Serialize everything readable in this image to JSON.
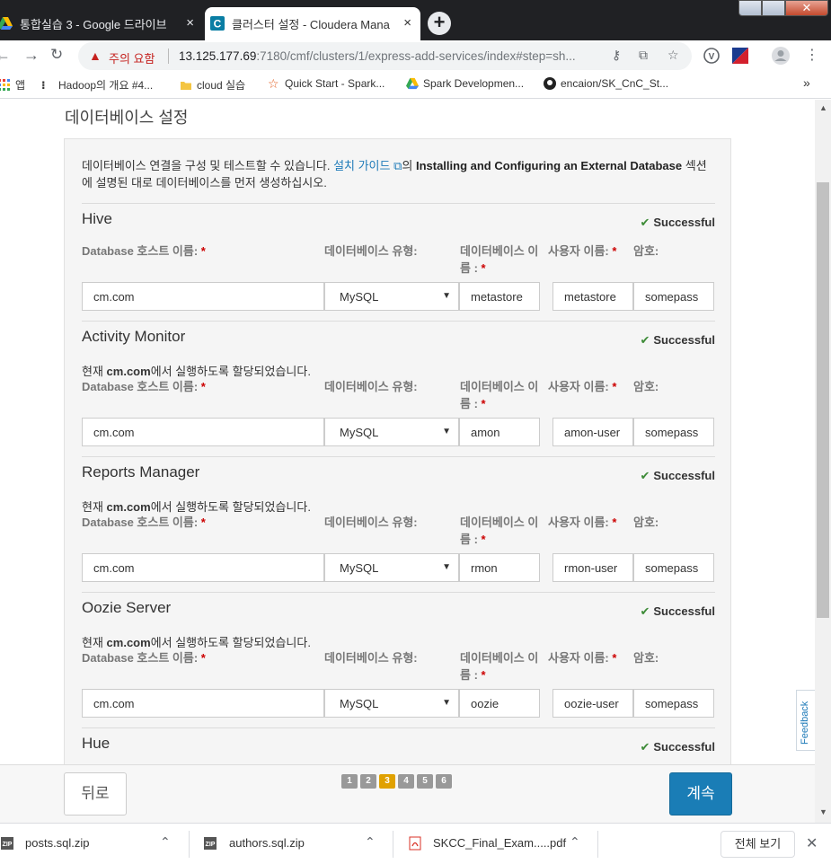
{
  "browser": {
    "tabs": [
      {
        "title": "통합실습 3 - Google 드라이브",
        "close": "×"
      },
      {
        "title": "클러스터 설정 - Cloudera Mana",
        "close": "×"
      }
    ],
    "new_tab": "+",
    "window_close": "✕",
    "security_warning": "주의 요함",
    "url_host": "13.125.177.69",
    "url_rest": ":7180/cmf/clusters/1/express-add-services/index#step=sh...",
    "bookmarks": [
      {
        "label": "앱"
      },
      {
        "label": "Hadoop의 개요 #4..."
      },
      {
        "label": "cloud 실습"
      },
      {
        "label": "Quick Start - Spark..."
      },
      {
        "label": "Spark Developmen..."
      },
      {
        "label": "encaion/SK_CnC_St..."
      }
    ],
    "more_bookmarks": "»"
  },
  "page": {
    "title": "데이터베이스 설정",
    "intro_text": "데이터베이스 연결을 구성 및 테스트할 수 있습니다. ",
    "intro_link": "설치 가이드",
    "intro_after_link": "의 ",
    "intro_bold": "Installing and Configuring an External Database",
    "intro_tail": " 섹션에 설명된 대로 데이터베이스를 먼저 생성하십시오.",
    "labels": {
      "host": "Database 호스트 이름:",
      "type": "데이터베이스 유형:",
      "name_line1": "데이터베이스 이",
      "name_line2": "름 :",
      "user": "사용자 이름:",
      "password": "암호:",
      "required": "*"
    },
    "note_prefix": "현재 ",
    "note_host": "cm.com",
    "note_suffix": "에서 실행하도록 할당되었습니다.",
    "services": [
      {
        "name": "Hive",
        "status": "Successful",
        "host": "cm.com",
        "db_type": "MySQL",
        "db_name": "metastore",
        "user": "metastore",
        "password": "somepass"
      },
      {
        "name": "Activity Monitor",
        "status": "Successful",
        "host": "cm.com",
        "db_type": "MySQL",
        "db_name": "amon",
        "user": "amon-user",
        "password": "somepass"
      },
      {
        "name": "Reports Manager",
        "status": "Successful",
        "host": "cm.com",
        "db_type": "MySQL",
        "db_name": "rmon",
        "user": "rmon-user",
        "password": "somepass"
      },
      {
        "name": "Oozie Server",
        "status": "Successful",
        "host": "cm.com",
        "db_type": "MySQL",
        "db_name": "oozie",
        "user": "oozie-user",
        "password": "somepass"
      },
      {
        "name": "Hue",
        "status": "Successful"
      }
    ],
    "feedback": "Feedback"
  },
  "footer": {
    "back": "뒤로",
    "next": "계속",
    "steps": [
      "1",
      "2",
      "3",
      "4",
      "5",
      "6"
    ],
    "current_step": 3
  },
  "downloads": {
    "items": [
      {
        "name": "posts.sql.zip"
      },
      {
        "name": "authors.sql.zip"
      },
      {
        "name": "SKCC_Final_Exam.....pdf"
      }
    ],
    "show_all": "전체 보기",
    "close": "✕"
  }
}
